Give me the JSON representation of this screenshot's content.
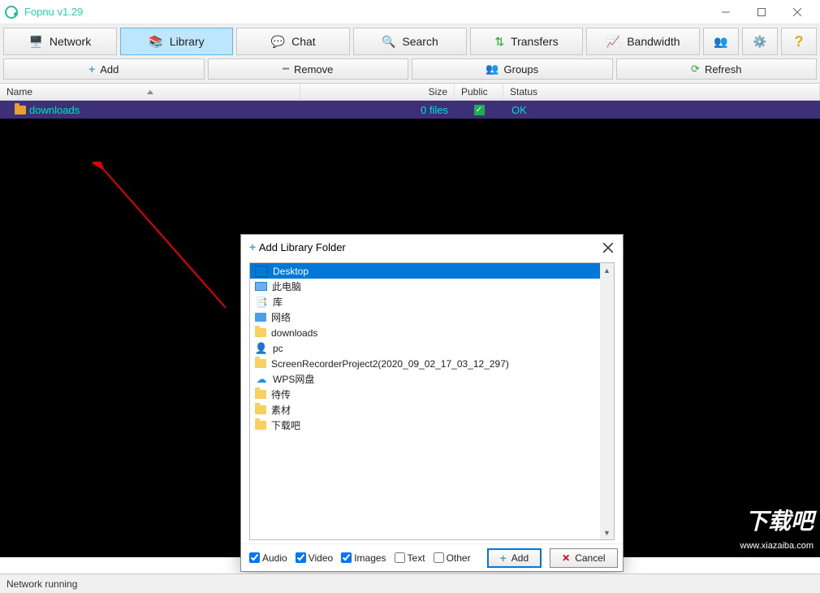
{
  "title": "Fopnu v1.29",
  "toolbar": {
    "network": "Network",
    "library": "Library",
    "chat": "Chat",
    "search": "Search",
    "transfers": "Transfers",
    "bandwidth": "Bandwidth"
  },
  "secondbar": {
    "add": "Add",
    "remove": "Remove",
    "groups": "Groups",
    "refresh": "Refresh"
  },
  "columns": {
    "name": "Name",
    "size": "Size",
    "public": "Public",
    "status": "Status"
  },
  "row": {
    "name": "downloads",
    "size": "0 files",
    "status": "OK"
  },
  "dialog": {
    "title": "Add Library Folder",
    "items": [
      {
        "icon": "desktop",
        "label": "Desktop",
        "sel": true
      },
      {
        "icon": "monitor",
        "label": "此电脑"
      },
      {
        "icon": "lib",
        "label": "库"
      },
      {
        "icon": "net",
        "label": "网络"
      },
      {
        "icon": "fold",
        "label": "downloads"
      },
      {
        "icon": "user",
        "label": "pc"
      },
      {
        "icon": "fold",
        "label": "ScreenRecorderProject2(2020_09_02_17_03_12_297)"
      },
      {
        "icon": "cloud",
        "label": "WPS网盘"
      },
      {
        "icon": "fold",
        "label": "待传"
      },
      {
        "icon": "fold",
        "label": "素材"
      },
      {
        "icon": "fold",
        "label": "下载吧"
      }
    ],
    "checks": {
      "audio": "Audio",
      "video": "Video",
      "images": "Images",
      "text": "Text",
      "other": "Other"
    },
    "add": "Add",
    "cancel": "Cancel"
  },
  "status": "Network running",
  "watermark": "下载吧",
  "watermark_sub": "www.xiazaiba.com"
}
